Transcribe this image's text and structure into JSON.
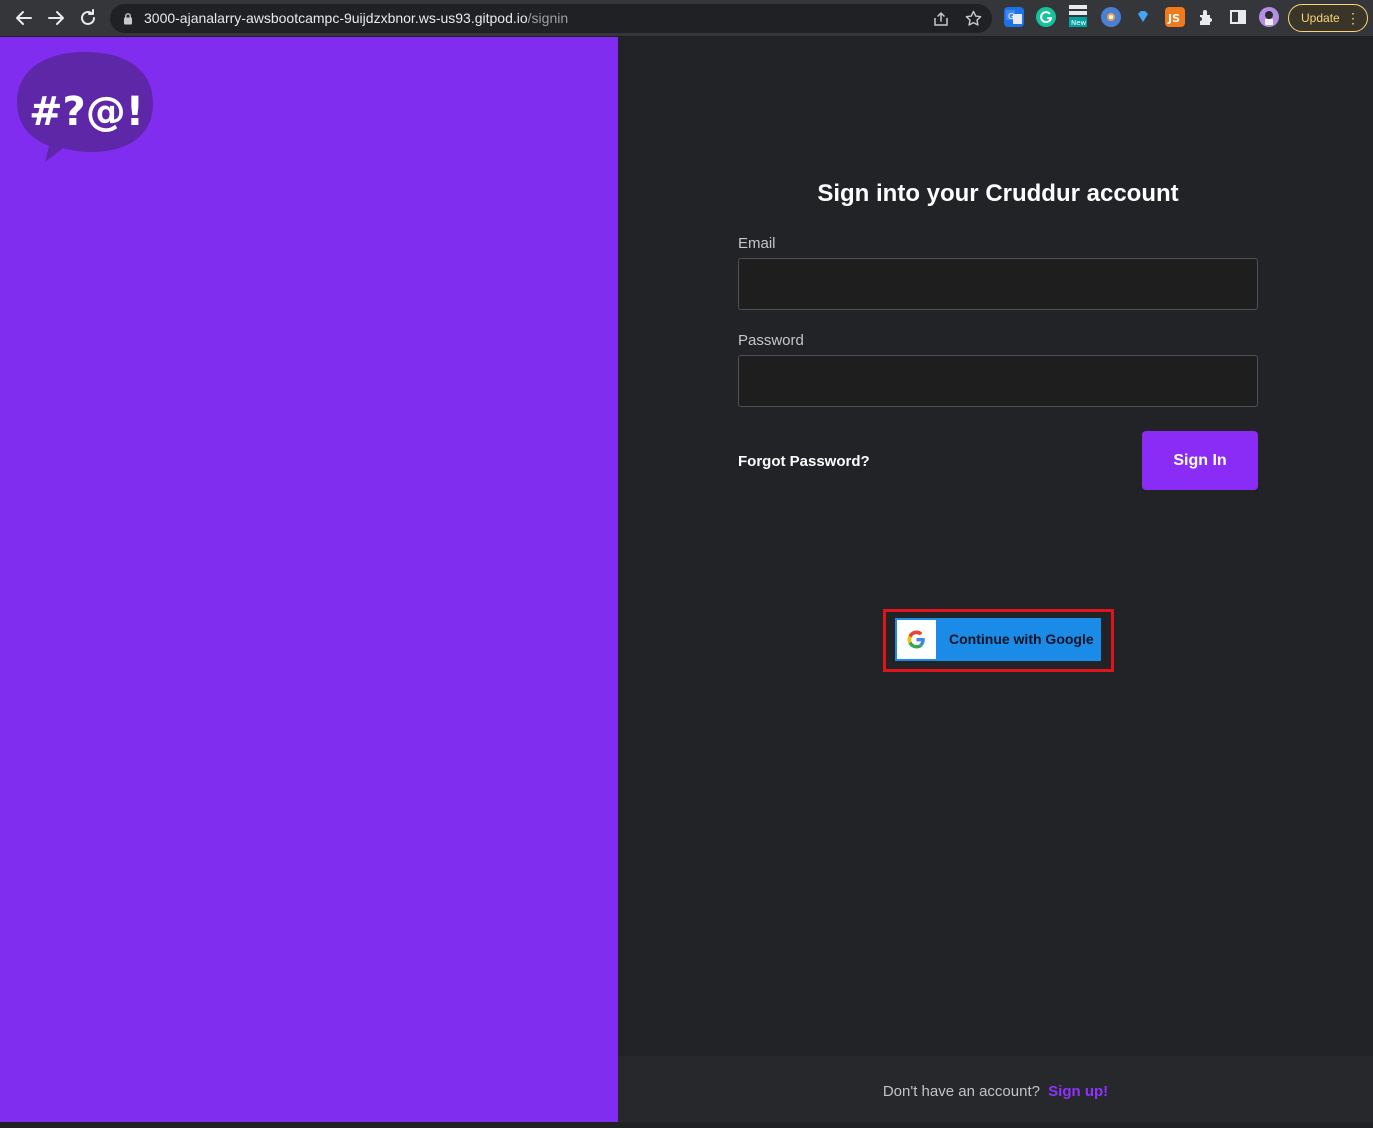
{
  "browser": {
    "url_host": "3000-ajanalarry-awsbootcampc-9uijdzxbnor.ws-us93.gitpod.io",
    "url_path": "/signin",
    "update_label": "Update",
    "new_badge": "New",
    "js_ext_label": "JS"
  },
  "logo": {
    "text": "#?@!"
  },
  "signin": {
    "heading": "Sign into your Cruddur account",
    "email_label": "Email",
    "email_value": "",
    "password_label": "Password",
    "password_value": "",
    "forgot_label": "Forgot Password?",
    "submit_label": "Sign In",
    "google_label": "Continue with Google"
  },
  "footer": {
    "prompt": "Don't have an account?",
    "signup_label": "Sign up!"
  },
  "colors": {
    "left_panel": "#812df0",
    "right_panel": "#222326",
    "primary_button": "#8b2bf6",
    "google_button": "#1a8ce8",
    "highlight_frame": "#e0141c",
    "signup_link": "#8f32ff"
  }
}
